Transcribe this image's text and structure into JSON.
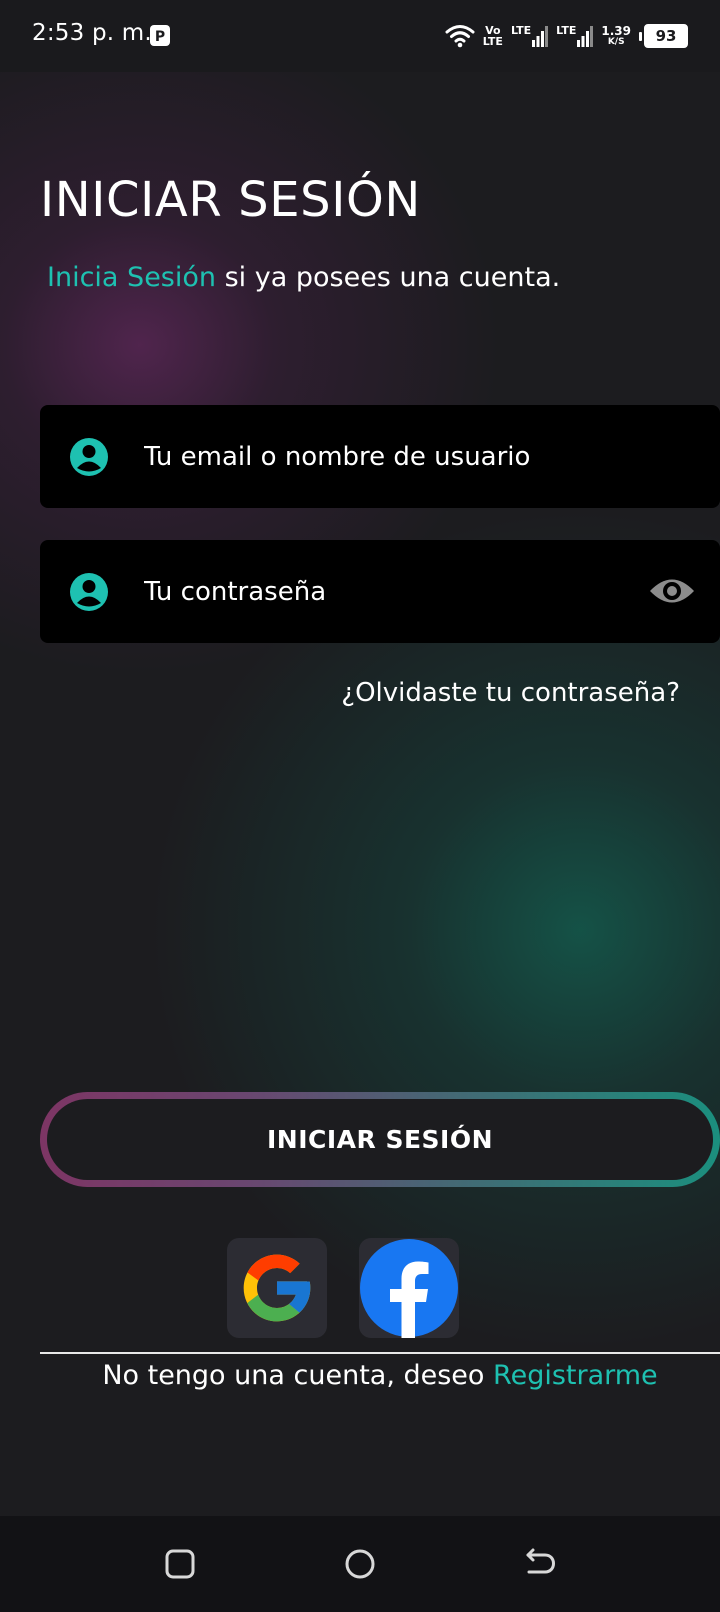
{
  "status_bar": {
    "time": "2:53 p. m.",
    "network_icons": [
      "p-app-icon",
      "wifi-icon",
      "volte-icon",
      "lte-signal-icon",
      "lte-signal-icon"
    ],
    "volte_label_top": "Vo",
    "volte_label_bottom": "LTE",
    "lte_label_1": "LTE",
    "lte_label_2": "LTE",
    "speed_value": "1.39",
    "speed_unit": "K/S",
    "battery_level": "93"
  },
  "login": {
    "title": "INICIAR SESIÓN",
    "subtitle_link": "Inicia Sesión",
    "subtitle_rest": " si ya posees una cuenta.",
    "email_placeholder": "Tu email o nombre de usuario",
    "password_placeholder": "Tu contraseña",
    "forgot_password": "¿Olvidaste tu contraseña?",
    "submit_label": "INICIAR SESIÓN",
    "social_buttons": [
      "google-icon",
      "facebook-icon"
    ],
    "register_text": "No tengo una cuenta, deseo ",
    "register_link": "Registrarme"
  },
  "nav_bar": {
    "icons": [
      "recents-icon",
      "home-icon",
      "back-icon"
    ]
  },
  "colors": {
    "accent": "#1ec1b1",
    "background": "#1c1c1f",
    "field_background": "#000000",
    "button_gradient_start": "#7d3564",
    "button_gradient_end": "#1b8f7e",
    "facebook_blue": "#1877f2"
  }
}
